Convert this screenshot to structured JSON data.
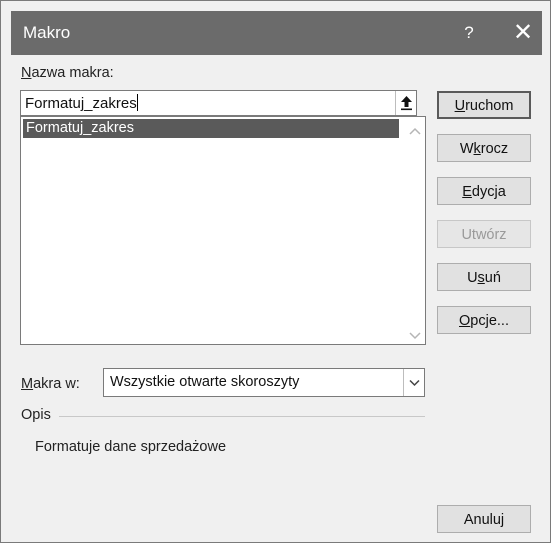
{
  "window": {
    "title": "Makro",
    "help_label": "?",
    "close_label": "✕"
  },
  "macro_name": {
    "label_accel": "N",
    "label_rest": "azwa makra:",
    "value": "Formatuj_zakres"
  },
  "macro_list": {
    "items": [
      "Formatuj_zakres"
    ],
    "selected_index": 0
  },
  "buttons": {
    "run": {
      "pre": "",
      "accel": "U",
      "post": "ruchom"
    },
    "step_into": {
      "pre": "W",
      "accel": "k",
      "post": "rocz"
    },
    "edit": {
      "pre": "",
      "accel": "E",
      "post": "dycja"
    },
    "create": {
      "label": "Utwórz",
      "enabled": false
    },
    "delete": {
      "pre": "U",
      "accel": "s",
      "post": "uń"
    },
    "options": {
      "pre": "",
      "accel": "O",
      "post": "pcje..."
    },
    "cancel": {
      "label": "Anuluj"
    }
  },
  "macros_in": {
    "label_accel": "M",
    "label_rest": "akra w:",
    "value": "Wszystkie otwarte skoroszyty"
  },
  "description": {
    "label": "Opis",
    "text": "Formatuje dane sprzedażowe"
  },
  "colors": {
    "titlebar": "#6b6b6b",
    "selection": "#5a5a5a",
    "dialog_bg": "#f0f0f0"
  },
  "icons": {
    "upload": "upload-arrow-icon",
    "scroll_up": "chevron-up-icon",
    "scroll_down": "chevron-down-icon",
    "dropdown": "chevron-down-icon"
  }
}
